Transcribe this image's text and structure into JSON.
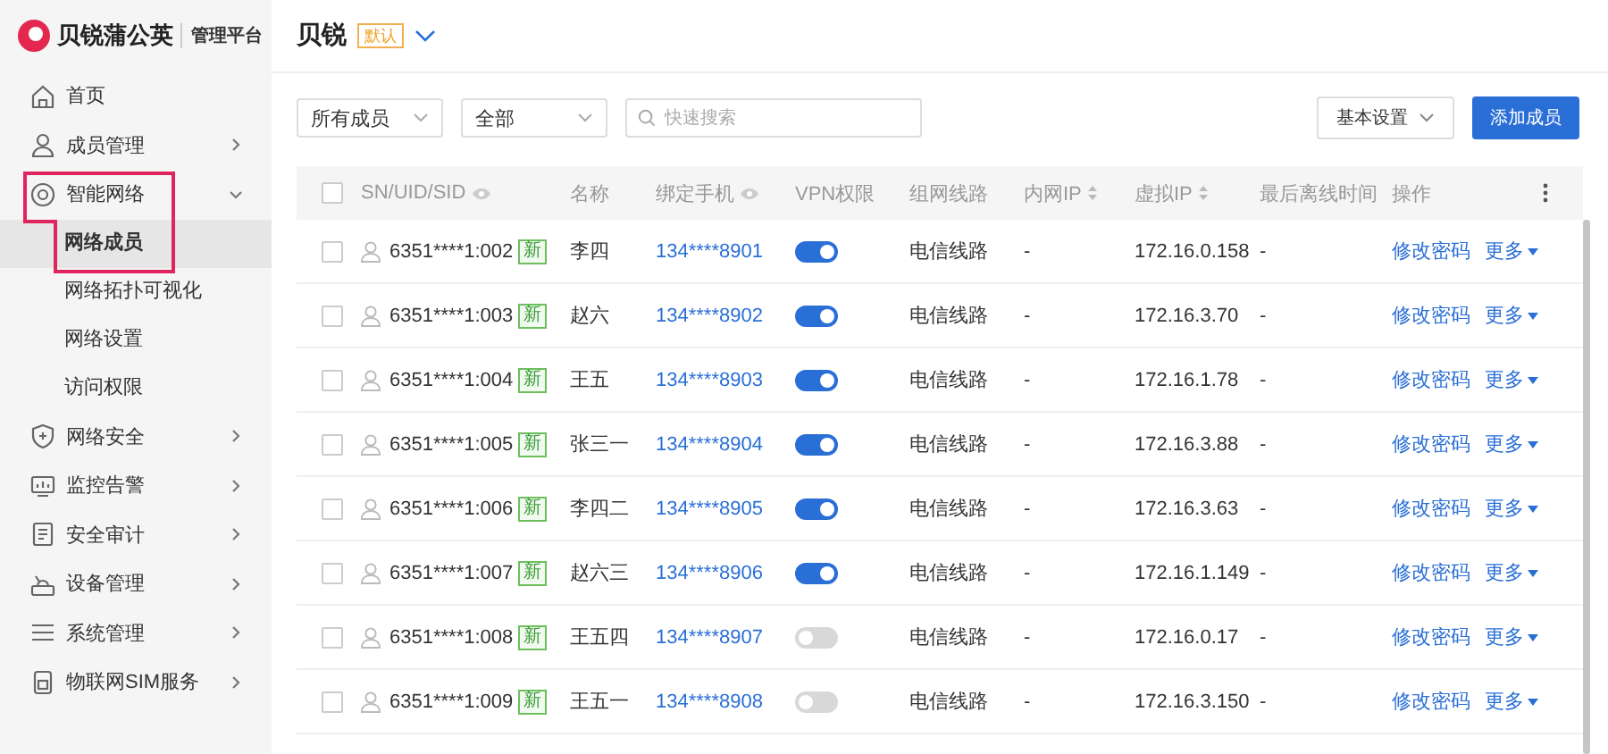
{
  "brand": {
    "name": "贝锐蒲公英",
    "subtitle": "管理平台"
  },
  "sidebar": {
    "items": [
      {
        "label": "首页"
      },
      {
        "label": "成员管理",
        "expanded": false
      },
      {
        "label": "智能网络",
        "expanded": true,
        "children": [
          {
            "label": "网络成员",
            "selected": true
          },
          {
            "label": "网络拓扑可视化",
            "selected": false
          },
          {
            "label": "网络设置",
            "selected": false
          },
          {
            "label": "访问权限",
            "selected": false
          }
        ]
      },
      {
        "label": "网络安全",
        "expanded": false
      },
      {
        "label": "监控告警",
        "expanded": false
      },
      {
        "label": "安全审计",
        "expanded": false
      },
      {
        "label": "设备管理",
        "expanded": false
      },
      {
        "label": "系统管理",
        "expanded": false
      },
      {
        "label": "物联网SIM服务",
        "expanded": false
      }
    ]
  },
  "header": {
    "network": "贝锐",
    "badge": "默认"
  },
  "toolbar": {
    "member_filter": "所有成员",
    "status_filter": "全部",
    "search": {
      "placeholder": "快速搜索"
    },
    "settings_button": "基本设置",
    "add_button": "添加成员"
  },
  "table": {
    "select_all_checked": false,
    "columns": [
      {
        "label": "SN/UID/SID",
        "kind": "masked"
      },
      {
        "label": "名称",
        "kind": "plain"
      },
      {
        "label": "绑定手机",
        "kind": "masked"
      },
      {
        "label": "VPN权限",
        "kind": "plain"
      },
      {
        "label": "组网线路",
        "kind": "plain"
      },
      {
        "label": "内网IP",
        "kind": "sortable"
      },
      {
        "label": "虚拟IP",
        "kind": "sortable"
      },
      {
        "label": "最后离线时间",
        "kind": "plain"
      },
      {
        "label": "操作",
        "kind": "plain"
      }
    ],
    "rows": [
      {
        "checked": false,
        "sn": "6351****1:002",
        "badge": "新",
        "name": "李四",
        "phone": "134****8901",
        "vpn_on": true,
        "route": "电信线路",
        "lan_ip": "-",
        "virtual_ip": "172.16.0.158",
        "last_offline": "-",
        "edit": "修改密码",
        "more": "更多"
      },
      {
        "checked": false,
        "sn": "6351****1:003",
        "badge": "新",
        "name": "赵六",
        "phone": "134****8902",
        "vpn_on": true,
        "route": "电信线路",
        "lan_ip": "-",
        "virtual_ip": "172.16.3.70",
        "last_offline": "-",
        "edit": "修改密码",
        "more": "更多"
      },
      {
        "checked": false,
        "sn": "6351****1:004",
        "badge": "新",
        "name": "王五",
        "phone": "134****8903",
        "vpn_on": true,
        "route": "电信线路",
        "lan_ip": "-",
        "virtual_ip": "172.16.1.78",
        "last_offline": "-",
        "edit": "修改密码",
        "more": "更多"
      },
      {
        "checked": false,
        "sn": "6351****1:005",
        "badge": "新",
        "name": "张三一",
        "phone": "134****8904",
        "vpn_on": true,
        "route": "电信线路",
        "lan_ip": "-",
        "virtual_ip": "172.16.3.88",
        "last_offline": "-",
        "edit": "修改密码",
        "more": "更多"
      },
      {
        "checked": false,
        "sn": "6351****1:006",
        "badge": "新",
        "name": "李四二",
        "phone": "134****8905",
        "vpn_on": true,
        "route": "电信线路",
        "lan_ip": "-",
        "virtual_ip": "172.16.3.63",
        "last_offline": "-",
        "edit": "修改密码",
        "more": "更多"
      },
      {
        "checked": false,
        "sn": "6351****1:007",
        "badge": "新",
        "name": "赵六三",
        "phone": "134****8906",
        "vpn_on": true,
        "route": "电信线路",
        "lan_ip": "-",
        "virtual_ip": "172.16.1.149",
        "last_offline": "-",
        "edit": "修改密码",
        "more": "更多"
      },
      {
        "checked": false,
        "sn": "6351****1:008",
        "badge": "新",
        "name": "王五四",
        "phone": "134****8907",
        "vpn_on": false,
        "route": "电信线路",
        "lan_ip": "-",
        "virtual_ip": "172.16.0.17",
        "last_offline": "-",
        "edit": "修改密码",
        "more": "更多"
      },
      {
        "checked": false,
        "sn": "6351****1:009",
        "badge": "新",
        "name": "王五一",
        "phone": "134****8908",
        "vpn_on": false,
        "route": "电信线路",
        "lan_ip": "-",
        "virtual_ip": "172.16.3.150",
        "last_offline": "-",
        "edit": "修改密码",
        "more": "更多"
      }
    ]
  }
}
